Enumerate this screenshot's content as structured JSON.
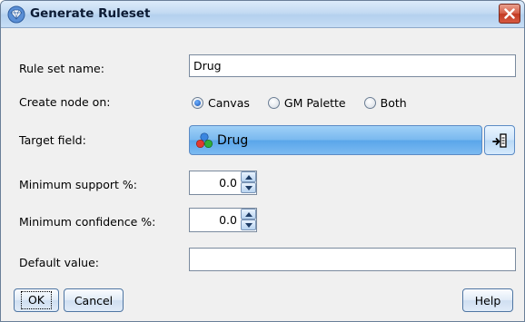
{
  "window": {
    "title": "Generate Ruleset",
    "close_icon": "close-x-icon",
    "app_icon": "diamond-gem-icon"
  },
  "form": {
    "rule_set_name": {
      "label": "Rule set name:",
      "value": "Drug"
    },
    "create_node_on": {
      "label": "Create node on:",
      "options": [
        "Canvas",
        "GM Palette",
        "Both"
      ],
      "selected": "Canvas"
    },
    "target_field": {
      "label": "Target field:",
      "value": "Drug",
      "icon": "nominal-field-icon",
      "picker_icon": "field-picker-icon"
    },
    "minimum_support": {
      "label": "Minimum support %:",
      "value": "0.0"
    },
    "minimum_confidence": {
      "label": "Minimum confidence %:",
      "value": "0.0"
    },
    "default_value": {
      "label": "Default value:",
      "value": ""
    }
  },
  "buttons": {
    "ok": "OK",
    "cancel": "Cancel",
    "help": "Help"
  },
  "colors": {
    "titlebar": "#c3daf2",
    "close_button": "#d6604a",
    "field_button": "#7ab9ef",
    "dialog_bg": "#f0f0f0"
  }
}
